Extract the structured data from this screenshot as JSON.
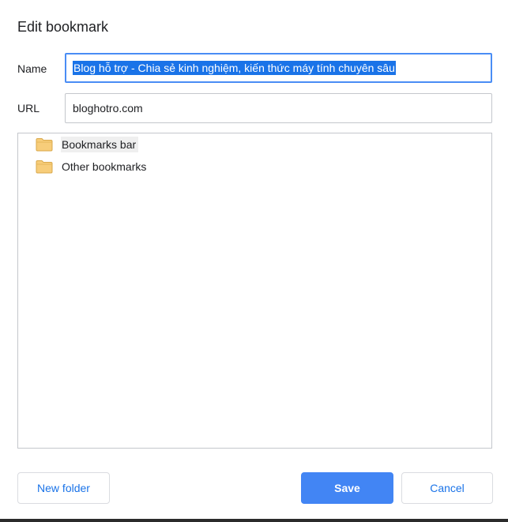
{
  "dialog": {
    "title": "Edit bookmark"
  },
  "fields": {
    "name_label": "Name",
    "name_value": "Blog hỗ trợ - Chia sẻ kinh nghiệm, kiến thức máy tính chuyên sâu",
    "url_label": "URL",
    "url_value": "bloghotro.com"
  },
  "tree": {
    "items": [
      {
        "label": "Bookmarks bar",
        "icon": "folder-icon"
      },
      {
        "label": "Other bookmarks",
        "icon": "folder-icon"
      }
    ]
  },
  "buttons": {
    "new_folder": "New folder",
    "save": "Save",
    "cancel": "Cancel"
  },
  "colors": {
    "accent": "#1a73e8",
    "save_bg": "#4285f4",
    "focus_border": "#4a8df5",
    "folder_fill": "#f7cd7a"
  }
}
